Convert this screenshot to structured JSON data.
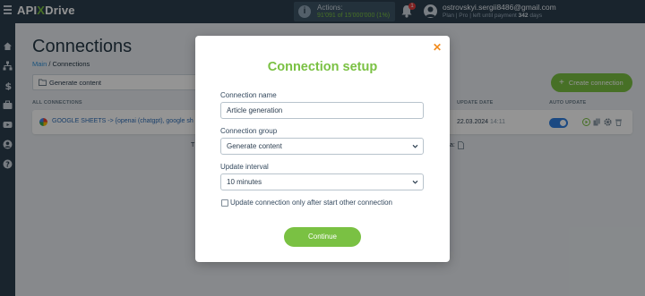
{
  "topbar": {
    "logo_api": "API",
    "logo_x": "X",
    "logo_drive": "Drive",
    "actions_title": "Actions:",
    "actions_count": "91'091 of 15'000'000 (1%)",
    "notification_count": "1",
    "user_email": "ostrovskyi.sergii8486@gmail.com",
    "user_plan_prefix": "Plan | Pro | left until payment ",
    "user_plan_days": "342",
    "user_plan_suffix": " days"
  },
  "sidebar": {
    "items": [
      "home-icon",
      "network-icon",
      "dollar-icon",
      "briefcase-icon",
      "video-icon",
      "user-icon",
      "help-icon"
    ]
  },
  "main": {
    "title": "Connections",
    "breadcrumb_link": "Main",
    "breadcrumb_sep": "/",
    "breadcrumb_current": "Connections",
    "group_filter": "Generate content",
    "create_button": "Create connection",
    "columns": {
      "all_connections": "ALL CONNECTIONS",
      "update_date": "UPDATE DATE",
      "auto_update": "AUTO UPDATE"
    },
    "row": {
      "name": "GOOGLE SHEETS -> {openai (chatgpt), google sh",
      "date": "22.03.2024",
      "time": "14:11",
      "auto_update_on": true
    },
    "footer_left": "T",
    "footer_right": "a:"
  },
  "modal": {
    "title": "Connection setup",
    "close_icon": "close-icon",
    "name_label": "Connection name",
    "name_value": "Article generation",
    "group_label": "Connection group",
    "group_value": "Generate content",
    "interval_label": "Update interval",
    "interval_value": "10 minutes",
    "checkbox_label": "Update connection only after start other connection",
    "checkbox_checked": false,
    "continue_label": "Continue"
  },
  "colors": {
    "accent_green": "#7ac143",
    "topbar": "#2c3e4f",
    "close_orange": "#f28c1e",
    "link_blue": "#2f8fd8"
  }
}
